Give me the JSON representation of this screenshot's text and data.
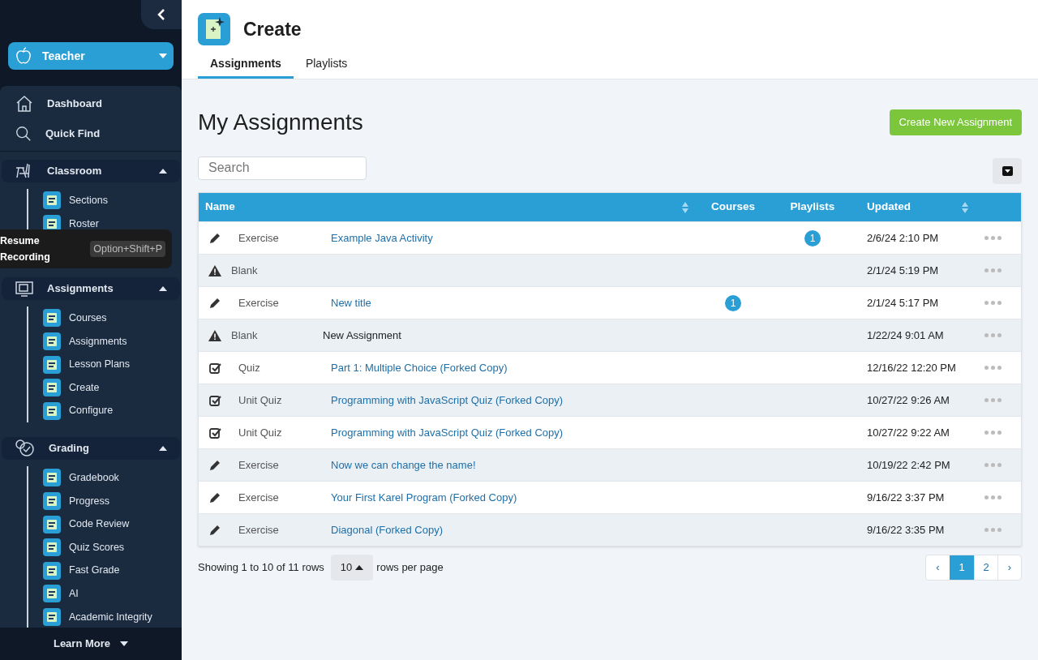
{
  "sidebar": {
    "role_button": "Teacher",
    "nav": [
      {
        "kind": "home",
        "label": "Dashboard"
      },
      {
        "kind": "search",
        "label": "Quick Find"
      }
    ],
    "groups": [
      {
        "kind": "classroom",
        "label": "Classroom",
        "expanded": true,
        "items": [
          "Sections",
          "Roster"
        ]
      },
      {
        "kind": "assignments",
        "label": "Assignments",
        "expanded": true,
        "items": [
          "Courses",
          "Assignments",
          "Lesson Plans",
          "Create",
          "Configure"
        ]
      },
      {
        "kind": "grading",
        "label": "Grading",
        "expanded": true,
        "items": [
          "Gradebook",
          "Progress",
          "Code Review",
          "Quiz Scores",
          "Fast Grade",
          "AI",
          "Academic Integrity"
        ]
      }
    ],
    "learn_more": "Learn More"
  },
  "tooltip": {
    "label": "Resume Recording",
    "shortcut": "Option+Shift+P"
  },
  "header": {
    "title": "Create",
    "tabs": [
      {
        "label": "Assignments",
        "selected": true
      },
      {
        "label": "Playlists",
        "selected": false
      }
    ]
  },
  "page_title": "My Assignments",
  "create_button": "Create New Assignment",
  "search": {
    "placeholder": "Search"
  },
  "table": {
    "columns": [
      "Name",
      "Courses",
      "Playlists",
      "Updated"
    ],
    "rows": [
      {
        "kind": "pencil",
        "type": "Exercise",
        "title": "Example Java Activity",
        "link": true,
        "playlists": "1",
        "updated": "2/6/24 2:10 PM"
      },
      {
        "kind": "warning",
        "type": "Blank",
        "updated": "2/1/24 5:19 PM"
      },
      {
        "kind": "pencil",
        "type": "Exercise",
        "title": "New title",
        "link": true,
        "courses": "1",
        "updated": "2/1/24 5:17 PM"
      },
      {
        "kind": "warning",
        "type": "Blank",
        "title": "New Assignment",
        "link": false,
        "updated": "1/22/24 9:01 AM"
      },
      {
        "kind": "check",
        "type": "Quiz",
        "title": "Part 1: Multiple Choice (Forked Copy)",
        "link": true,
        "updated": "12/16/22 12:20 PM"
      },
      {
        "kind": "check",
        "type": "Unit Quiz",
        "title": "Programming with JavaScript Quiz (Forked Copy)",
        "link": true,
        "updated": "10/27/22 9:26 AM"
      },
      {
        "kind": "check",
        "type": "Unit Quiz",
        "title": "Programming with JavaScript Quiz (Forked Copy)",
        "link": true,
        "updated": "10/27/22 9:22 AM"
      },
      {
        "kind": "pencil",
        "type": "Exercise",
        "title": "Now we can change the name!",
        "link": true,
        "updated": "10/19/22 2:42 PM"
      },
      {
        "kind": "pencil",
        "type": "Exercise",
        "title": "Your First Karel Program (Forked Copy)",
        "link": true,
        "updated": "9/16/22 3:37 PM"
      },
      {
        "kind": "pencil",
        "type": "Exercise",
        "title": "Diagonal (Forked Copy)",
        "link": true,
        "updated": "9/16/22 3:35 PM"
      }
    ]
  },
  "footer": {
    "showing": "Showing 1 to 10 of 11 rows",
    "page_size": "10",
    "per_page": "rows per page",
    "pages": [
      {
        "label": "‹",
        "selected": false
      },
      {
        "label": "1",
        "selected": true
      },
      {
        "label": "2",
        "selected": false
      },
      {
        "label": "›",
        "selected": false
      }
    ]
  }
}
